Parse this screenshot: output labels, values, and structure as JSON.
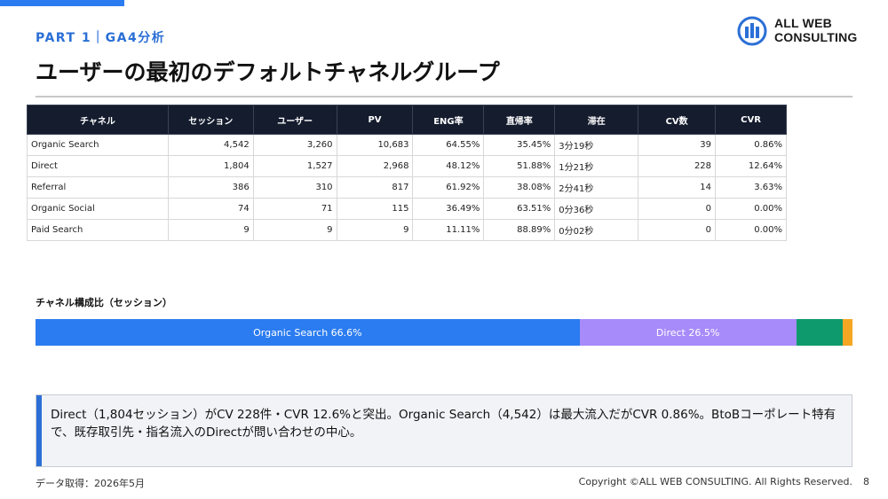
{
  "header": {
    "part_label": "PART 1｜GA4分析",
    "title": "ユーザーの最初のデフォルトチャネルグループ"
  },
  "logo": {
    "line1": "ALL WEB",
    "line2": "CONSULTING",
    "icon": "building-logo-icon"
  },
  "table": {
    "columns": [
      "チャネル",
      "セッション",
      "ユーザー",
      "PV",
      "ENG率",
      "直帰率",
      "滞在",
      "CV数",
      "CVR"
    ],
    "rows": [
      [
        "Organic Search",
        "4,542",
        "3,260",
        "10,683",
        "64.55%",
        "35.45%",
        "3分19秒",
        "39",
        "0.86%"
      ],
      [
        "Direct",
        "1,804",
        "1,527",
        "2,968",
        "48.12%",
        "51.88%",
        "1分21秒",
        "228",
        "12.64%"
      ],
      [
        "Referral",
        "386",
        "310",
        "817",
        "61.92%",
        "38.08%",
        "2分41秒",
        "14",
        "3.63%"
      ],
      [
        "Organic Social",
        "74",
        "71",
        "115",
        "36.49%",
        "63.51%",
        "0分36秒",
        "0",
        "0.00%"
      ],
      [
        "Paid Search",
        "9",
        "9",
        "9",
        "11.11%",
        "88.89%",
        "0分02秒",
        "0",
        "0.00%"
      ]
    ]
  },
  "composition": {
    "label": "チャネル構成比（セッション）",
    "segments": [
      {
        "text": "Organic Search 66.6%",
        "share": 66.6,
        "color": "#2b7cf0"
      },
      {
        "text": "Direct 26.5%",
        "share": 26.5,
        "color": "#a78bfa"
      },
      {
        "text": "",
        "share": 5.7,
        "color": "#0f9a6e"
      },
      {
        "text": "",
        "share": 1.2,
        "color": "#f5a623"
      }
    ]
  },
  "note": {
    "text": "Direct（1,804セッション）がCV 228件・CVR 12.6%と突出。Organic Search（4,542）は最大流入だがCVR 0.86%。BtoBコーポレート特有で、既存取引先・指名流入のDirectが問い合わせの中心。"
  },
  "footer": {
    "left": "データ取得：2026年5月",
    "copyright": "Copyright ©ALL WEB CONSULTING. All Rights Reserved.",
    "page": "8"
  }
}
